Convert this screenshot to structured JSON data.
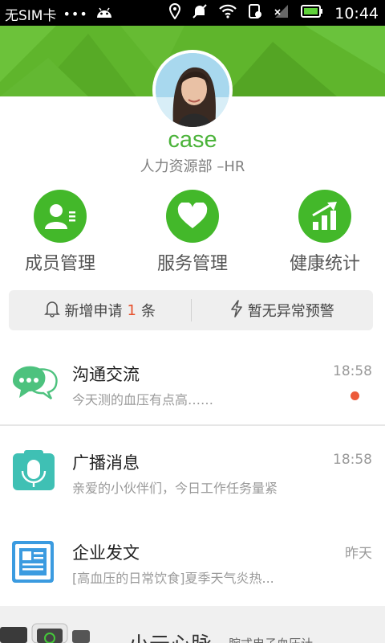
{
  "status_bar": {
    "carrier": "无SIM卡",
    "dots": "•••",
    "time": "10:44"
  },
  "profile": {
    "name": "case",
    "department": "人力资源部 –HR"
  },
  "quick_actions": [
    {
      "label": "成员管理",
      "icon": "member-icon"
    },
    {
      "label": "服务管理",
      "icon": "heart-icon"
    },
    {
      "label": "健康统计",
      "icon": "chart-up-icon"
    }
  ],
  "notice": {
    "new_request_prefix": "新增申请",
    "new_request_count": "1",
    "new_request_suffix": "条",
    "warning": "暂无异常预警"
  },
  "messages": [
    {
      "title": "沟通交流",
      "time": "18:58",
      "preview": "今天测的血压有点高……",
      "unread": true,
      "icon": "chat-icon"
    },
    {
      "title": "广播消息",
      "time": "18:58",
      "preview": "亲爱的小伙伴们，今日工作任务量紧",
      "unread": false,
      "icon": "microphone-icon"
    },
    {
      "title": "企业发文",
      "time": "昨天",
      "preview": "[高血压的日常饮食]夏季天气炎热...",
      "unread": false,
      "icon": "document-icon"
    }
  ],
  "banner": {
    "title": "小云心脉",
    "subtitle": "腕式电子血压计"
  },
  "colors": {
    "brand_green": "#43b82a",
    "header_green": "#5fb52c",
    "unread_red": "#ec5a3a",
    "count_red": "#e6502c"
  }
}
